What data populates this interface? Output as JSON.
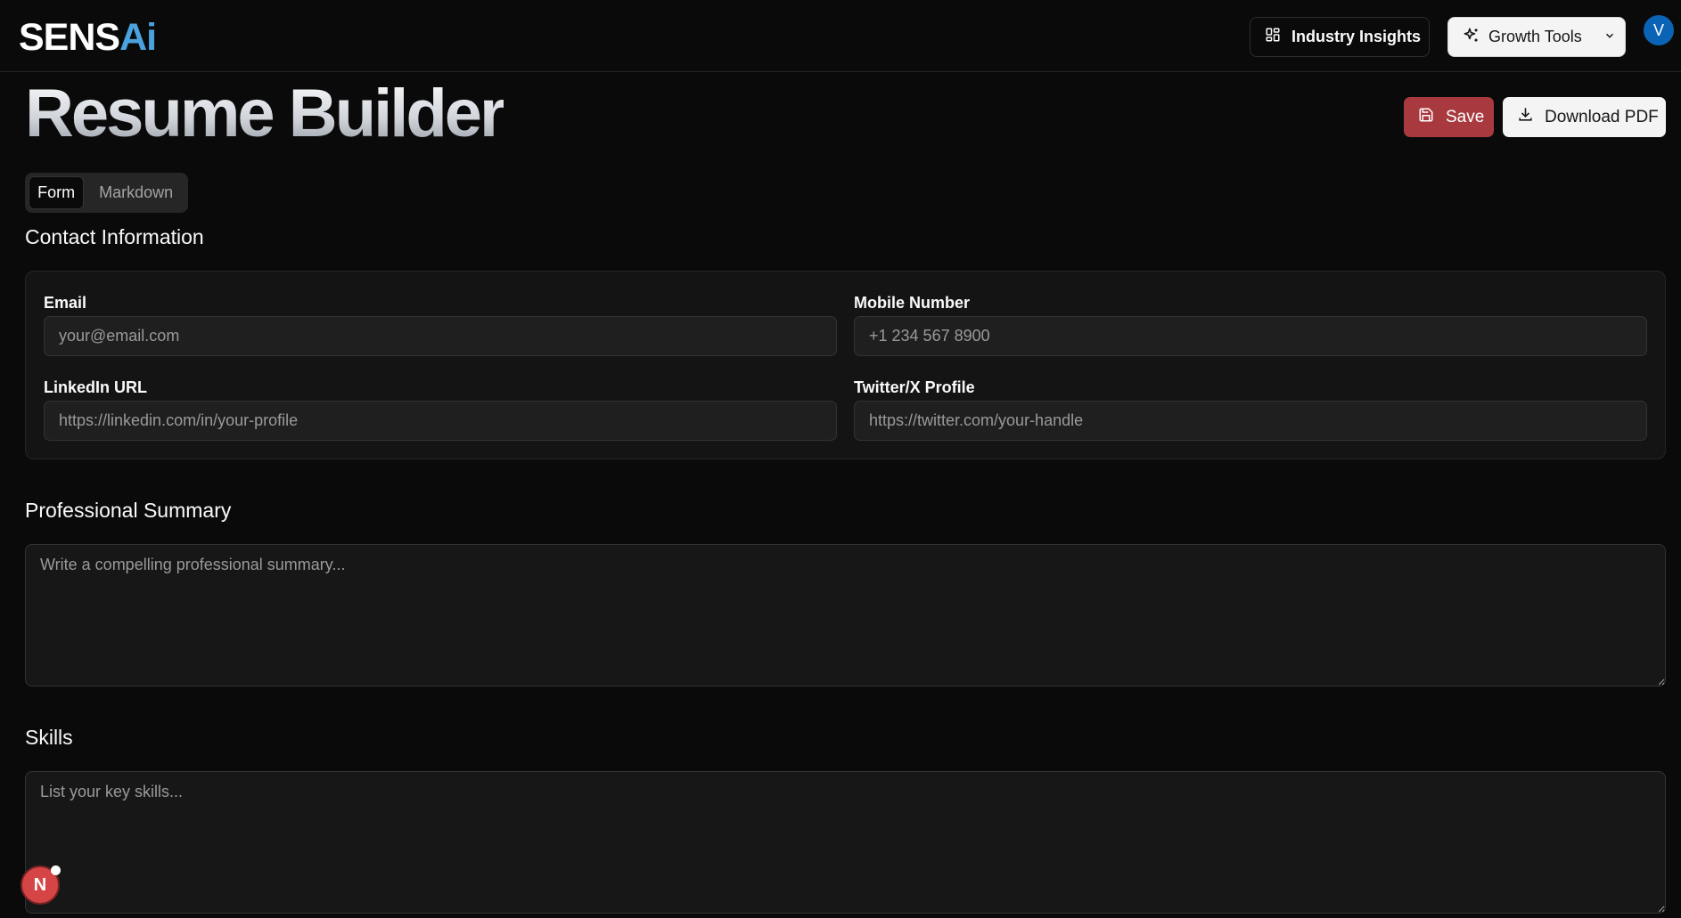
{
  "header": {
    "logo_main": "SENS",
    "logo_ai": "Ai",
    "industry_label": "Industry Insights",
    "growth_label": "Growth Tools",
    "avatar_initial": "V"
  },
  "page": {
    "title": "Resume Builder",
    "save_label": "Save",
    "pdf_label": "Download PDF"
  },
  "tabs": [
    {
      "label": "Form",
      "active": true
    },
    {
      "label": "Markdown",
      "active": false
    }
  ],
  "contact": {
    "title": "Contact Information",
    "email_label": "Email",
    "email_placeholder": "your@email.com",
    "mobile_label": "Mobile Number",
    "mobile_placeholder": "+1 234 567 8900",
    "linkedin_label": "LinkedIn URL",
    "linkedin_placeholder": "https://linkedin.com/in/your-profile",
    "twitter_label": "Twitter/X Profile",
    "twitter_placeholder": "https://twitter.com/your-handle"
  },
  "summary": {
    "title": "Professional Summary",
    "placeholder": "Write a compelling professional summary..."
  },
  "skills": {
    "title": "Skills",
    "placeholder": "List your key skills..."
  },
  "dev_badge": {
    "letter": "N"
  },
  "colors": {
    "background": "#0a0a0a",
    "save_button": "#a83a3f",
    "avatar": "#0b63b6",
    "logo_accent": "#4aa3df"
  }
}
